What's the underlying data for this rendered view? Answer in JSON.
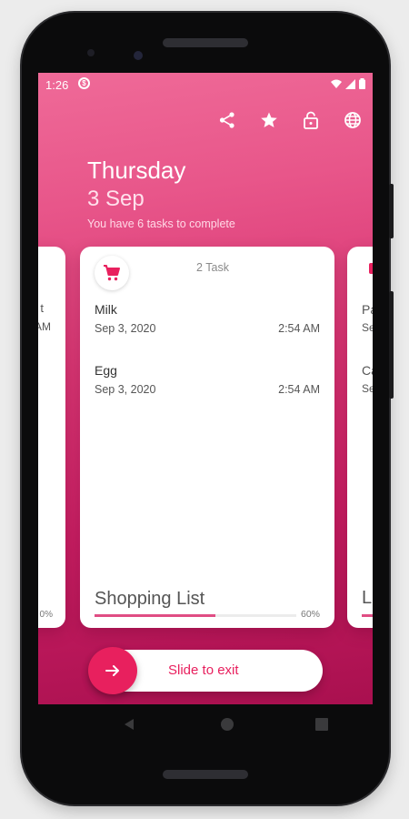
{
  "status_bar": {
    "time": "1:26",
    "notification_icon": "data-saver-icon",
    "right_icons": [
      "wifi-icon",
      "signal-icon",
      "battery-icon"
    ]
  },
  "toolbar": {
    "icons": [
      "share-icon",
      "star-icon",
      "lock-icon",
      "globe-icon"
    ]
  },
  "header": {
    "day": "Thursday",
    "date": "3 Sep",
    "subtitle": "You have 6 tasks to complete"
  },
  "main_card": {
    "icon": "cart-icon",
    "task_count": "2 Task",
    "items": [
      {
        "name": "Milk",
        "date": "Sep 3, 2020",
        "time": "2:54 AM"
      },
      {
        "name": "Egg",
        "date": "Sep 3, 2020",
        "time": "2:54 AM"
      }
    ],
    "title": "Shopping List",
    "progress": 0.6,
    "progress_label": "60%"
  },
  "left_card_peek": {
    "texts": [
      "t",
      "AM",
      "0%"
    ]
  },
  "right_card_peek": {
    "texts": [
      "Pa",
      "Se",
      "Ca",
      "Se",
      "Li"
    ]
  },
  "slider": {
    "label": "Slide to exit",
    "icon": "arrow-right-icon"
  },
  "navbar": {
    "icons": [
      "back-icon",
      "home-icon",
      "recents-icon"
    ]
  },
  "colors": {
    "accent": "#e8205e",
    "gradient_top": "#ef6a98",
    "gradient_bottom": "#a9104f"
  }
}
